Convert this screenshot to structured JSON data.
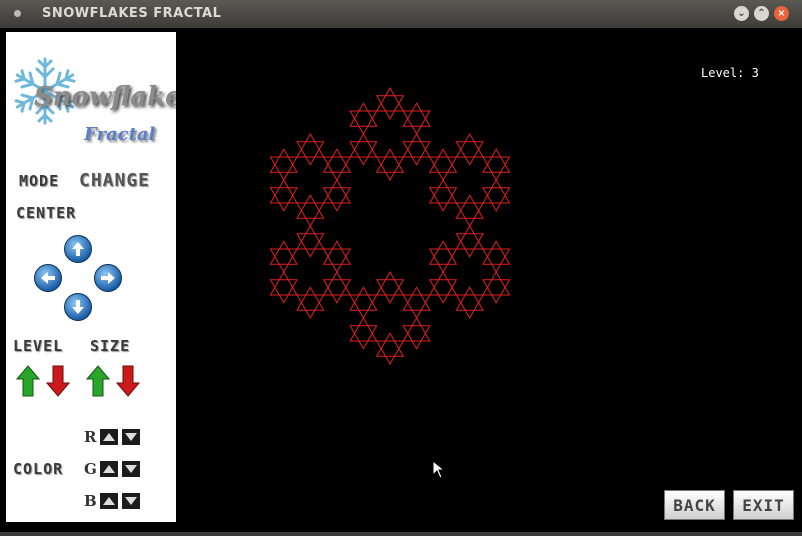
{
  "window": {
    "title": "SNOWFLAKES FRACTAL"
  },
  "logo": {
    "title": "Snowflakes",
    "subtitle": "Fractal"
  },
  "panel": {
    "mode_label": "MODE",
    "mode_button": "CHANGE",
    "center_label": "CENTER",
    "level_label": "LEVEL",
    "size_label": "SIZE",
    "color_label": "COLOR",
    "r_label": "R",
    "g_label": "G",
    "b_label": "B"
  },
  "canvas": {
    "level_text": "Level:  3",
    "level": 3,
    "stroke_color": "#e02020"
  },
  "buttons": {
    "back": "BACK",
    "exit": "EXIT"
  },
  "colors": {
    "arrow_up": "#2aa52a",
    "arrow_down": "#cc1a1a",
    "round_button": "#1b5fa8"
  }
}
